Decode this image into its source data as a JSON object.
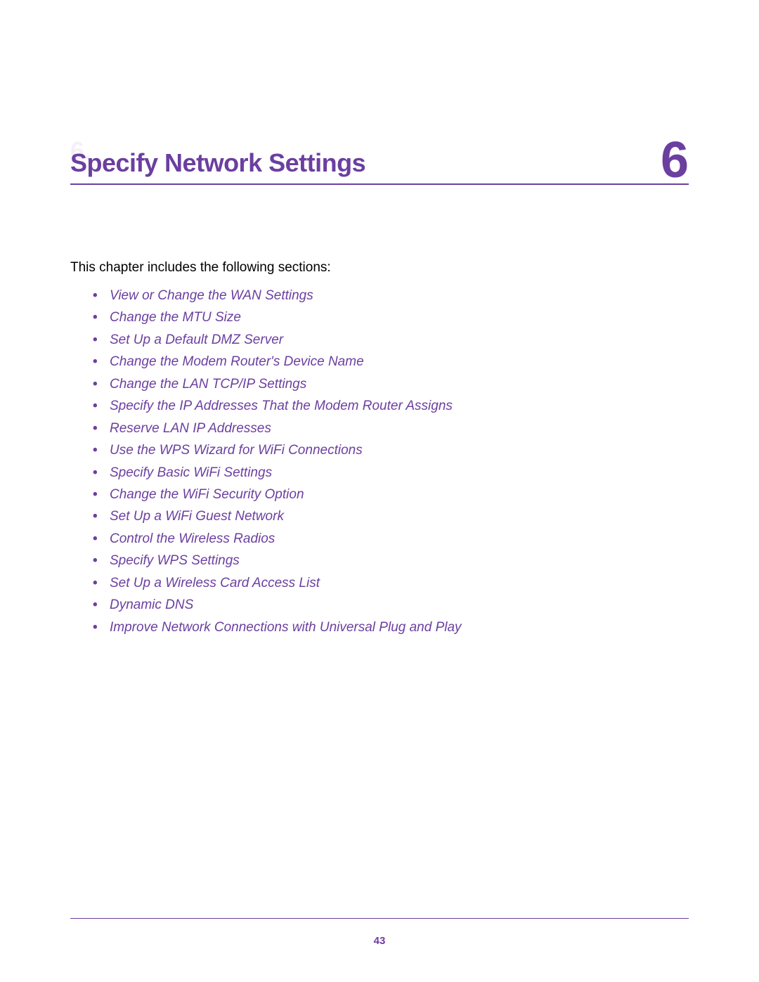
{
  "chapter": {
    "title": "Specify Network Settings",
    "number": "6",
    "ghost_number": "6."
  },
  "intro": "This chapter includes the following sections:",
  "sections": [
    "View or Change the WAN Settings",
    "Change the MTU Size",
    "Set Up a Default DMZ Server",
    "Change the Modem Router's Device Name",
    "Change the LAN TCP/IP Settings",
    "Specify the IP Addresses That the Modem Router Assigns",
    "Reserve LAN IP Addresses",
    "Use the WPS Wizard for WiFi Connections",
    "Specify Basic WiFi Settings",
    "Change the WiFi Security Option",
    "Set Up a WiFi Guest Network",
    "Control the Wireless Radios",
    "Specify WPS Settings",
    "Set Up a Wireless Card Access List",
    "Dynamic DNS",
    "Improve Network Connections with Universal Plug and Play"
  ],
  "page_number": "43"
}
